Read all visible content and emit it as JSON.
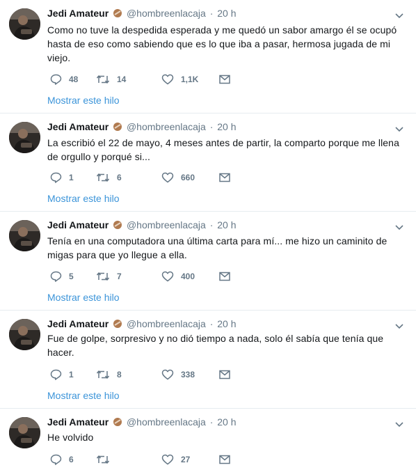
{
  "colors": {
    "text": "#14171a",
    "muted": "#657786",
    "link": "#3b94d9",
    "divider": "#e6ecf0"
  },
  "icons": {
    "reply": "reply-icon",
    "retweet": "retweet-icon",
    "like": "heart-icon",
    "dm": "envelope-icon",
    "more": "chevron-down-icon",
    "badge": "emoji-badge-icon"
  },
  "tweets": [
    {
      "name": "Jedi Amateur",
      "handle": "@hombreenlacaja",
      "separator": "·",
      "time": "20 h",
      "text": "Como no tuve la despedida esperada y me quedó un sabor amargo él se ocupó hasta de eso como sabiendo que es lo que iba a pasar, hermosa jugada de mi viejo.",
      "replies": "48",
      "retweets": "14",
      "likes": "1,1K",
      "show_thread": "Mostrar este hilo"
    },
    {
      "name": "Jedi Amateur",
      "handle": "@hombreenlacaja",
      "separator": "·",
      "time": "20 h",
      "text": "La escribió el 22 de mayo, 4 meses antes de partir, la comparto porque me llena de orgullo y porqué si...",
      "replies": "1",
      "retweets": "6",
      "likes": "660",
      "show_thread": "Mostrar este hilo"
    },
    {
      "name": "Jedi Amateur",
      "handle": "@hombreenlacaja",
      "separator": "·",
      "time": "20 h",
      "text": "Tenía en una computadora una última carta para mí... me hizo un caminito de migas para que yo llegue a ella.",
      "replies": "5",
      "retweets": "7",
      "likes": "400",
      "show_thread": "Mostrar este hilo"
    },
    {
      "name": "Jedi Amateur",
      "handle": "@hombreenlacaja",
      "separator": "·",
      "time": "20 h",
      "text": "Fue de golpe, sorpresivo y no dió tiempo a nada, solo él sabía que tenía que hacer.",
      "replies": "1",
      "retweets": "8",
      "likes": "338",
      "show_thread": "Mostrar este hilo"
    },
    {
      "name": "Jedi Amateur",
      "handle": "@hombreenlacaja",
      "separator": "·",
      "time": "20 h",
      "text": "He volvido",
      "replies": "6",
      "retweets": "",
      "likes": "27"
    }
  ]
}
